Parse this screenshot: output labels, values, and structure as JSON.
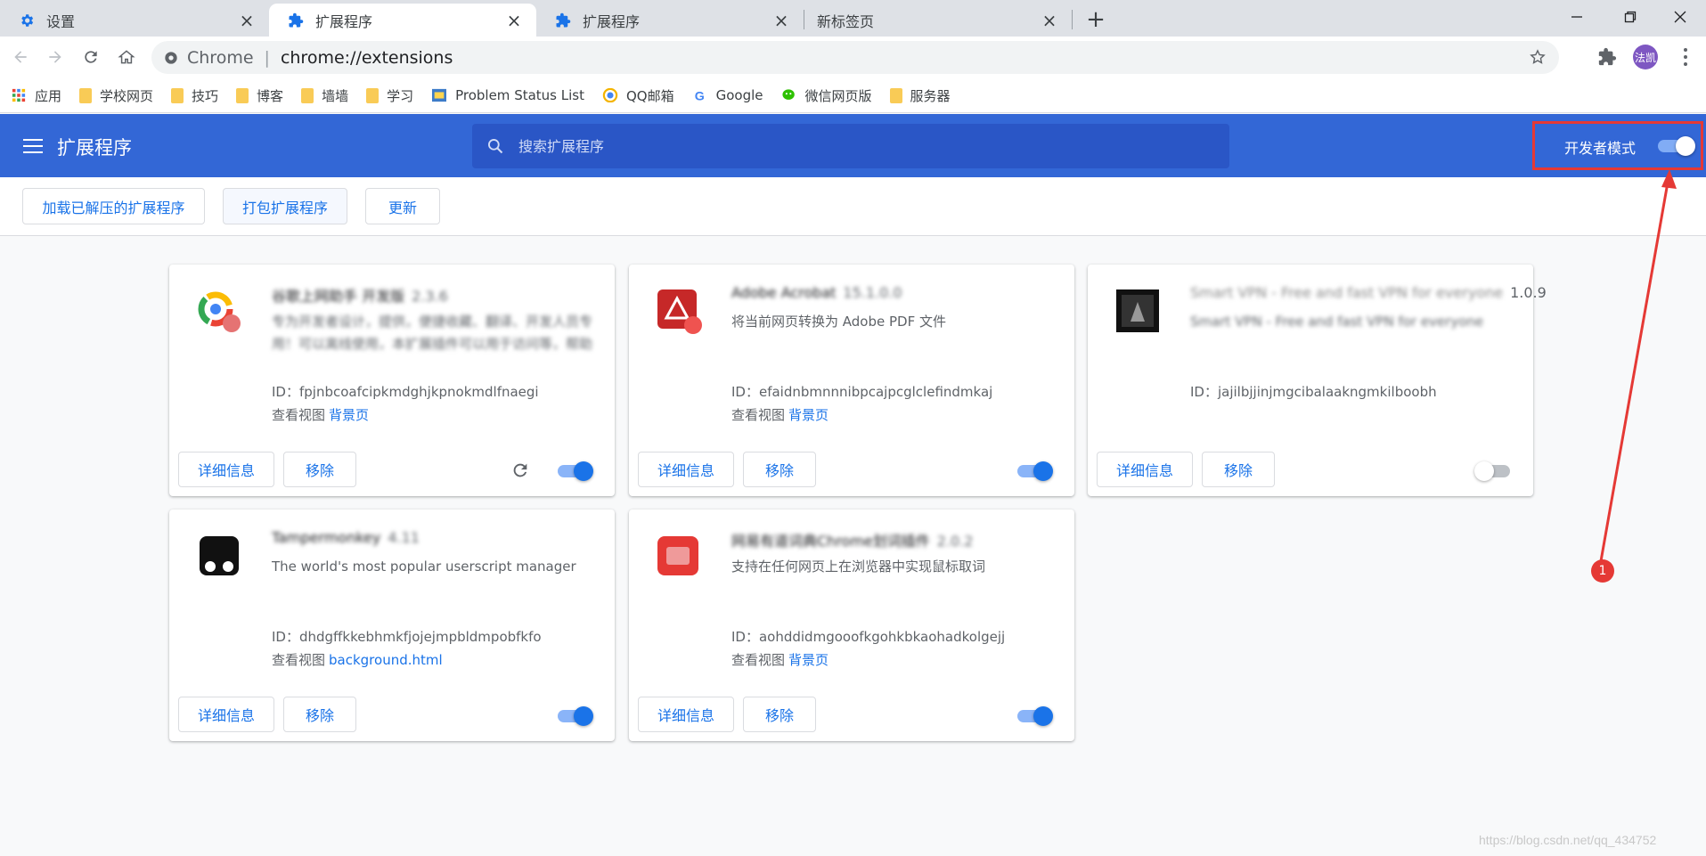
{
  "tabs": [
    {
      "title": "设置",
      "icon": "gear-icon"
    },
    {
      "title": "扩展程序",
      "icon": "puzzle-icon"
    },
    {
      "title": "扩展程序",
      "icon": "puzzle-icon"
    },
    {
      "title": "新标签页",
      "icon": ""
    }
  ],
  "omnibox": {
    "site_name": "Chrome",
    "separator": "|",
    "url": "chrome://extensions"
  },
  "profile": {
    "initials": "法凯"
  },
  "bookmarks": [
    {
      "label": "应用",
      "icon": "apps-grid-icon"
    },
    {
      "label": "学校网页",
      "icon": "folder-icon"
    },
    {
      "label": "技巧",
      "icon": "folder-icon"
    },
    {
      "label": "博客",
      "icon": "folder-icon"
    },
    {
      "label": "墙墙",
      "icon": "folder-icon"
    },
    {
      "label": "学习",
      "icon": "folder-icon"
    },
    {
      "label": "Problem Status List",
      "icon": "site-icon"
    },
    {
      "label": "QQ邮箱",
      "icon": "qq-mail-icon"
    },
    {
      "label": "Google",
      "icon": "google-icon"
    },
    {
      "label": "微信网页版",
      "icon": "wechat-icon"
    },
    {
      "label": "服务器",
      "icon": "folder-icon"
    }
  ],
  "header": {
    "title": "扩展程序",
    "search_placeholder": "搜索扩展程序",
    "dev_mode_label": "开发者模式",
    "dev_mode_on": true
  },
  "dev_bar": {
    "load_unpacked": "加载已解压的扩展程序",
    "pack": "打包扩展程序",
    "update": "更新"
  },
  "common": {
    "details": "详细信息",
    "remove": "移除",
    "views_label": "查看视图"
  },
  "cards": [
    {
      "name": "谷歌上网助手 开发版",
      "version": "2.3.6",
      "desc": "专为开发者设计，提供，便捷收藏、翻译、开发人员专用！可以离线使用，本扩展插件可以用于访问等，帮助",
      "id": "ID：fpjnbcoafcipkmdghjkpnokmdlfnaegi",
      "view_link": "背景页",
      "enabled": true,
      "has_reload": true
    },
    {
      "name": "Adobe Acrobat",
      "version": "15.1.0.0",
      "desc": "将当前网页转换为 Adobe PDF 文件",
      "id": "ID：efaidnbmnnnibpcajpcglclefindmkaj",
      "view_link": "背景页",
      "enabled": true,
      "has_reload": false
    },
    {
      "name": "Smart VPN - Free and fast VPN for everyone",
      "version": "1.0.9",
      "desc": "Smart VPN - Free and fast VPN for everyone",
      "id": "ID：jajilbjjinjmgcibalaakngmkilboobh",
      "view_link": "",
      "enabled": false,
      "has_reload": false
    },
    {
      "name": "Tampermonkey",
      "version": "4.11",
      "desc": "The world's most popular userscript manager",
      "id": "ID：dhdgffkkebhmkfjojejmpbldmpobfkfo",
      "view_link": "background.html",
      "enabled": true,
      "has_reload": false
    },
    {
      "name": "网易有道词典Chrome划词插件",
      "version": "2.0.2",
      "desc": "支持在任何网页上在浏览器中实现鼠标取词",
      "id": "ID：aohddidmgooofkgohkbkaohadkolgejj",
      "view_link": "背景页",
      "enabled": true,
      "has_reload": false
    }
  ],
  "annotation": {
    "number": "1",
    "color": "#e53935"
  },
  "watermark": "https://blog.csdn.net/qq_434752"
}
